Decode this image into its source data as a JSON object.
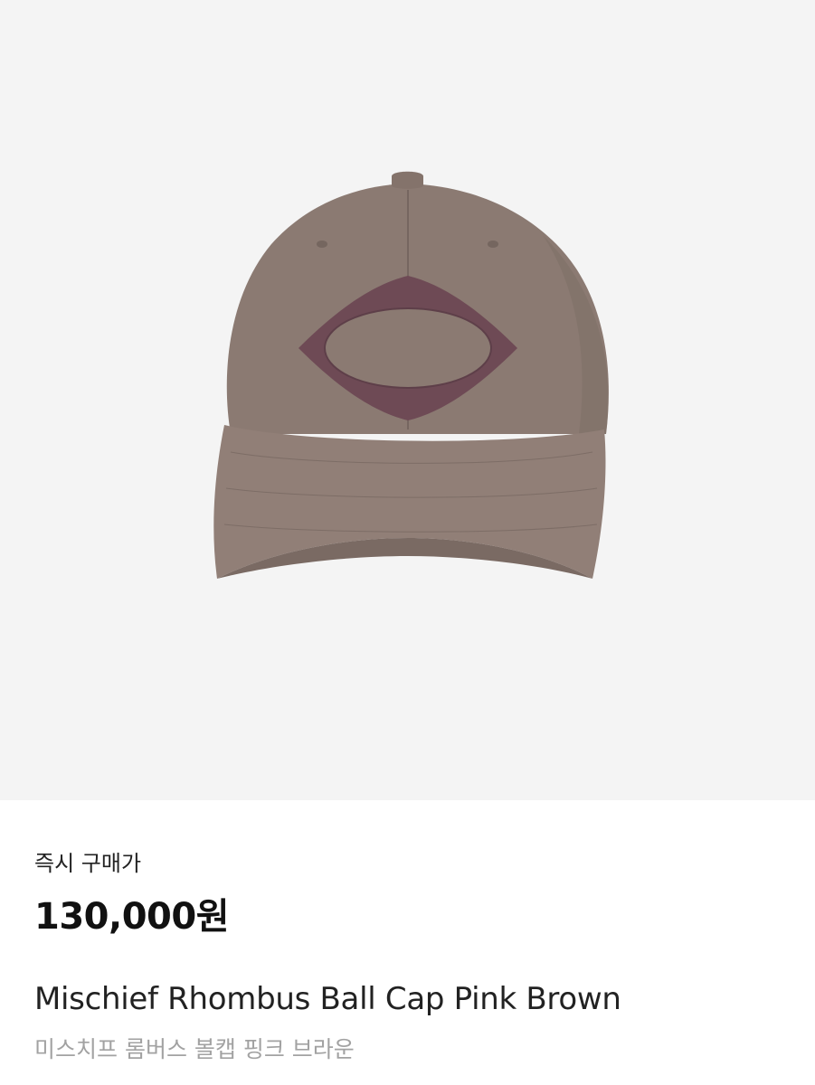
{
  "product": {
    "image_label": "cap-photo",
    "price_label": "즉시 구매가",
    "price": "130,000원",
    "name_en": "Mischief Rhombus Ball Cap Pink Brown",
    "name_ko": "미스치프 롬버스 볼캡 핑크 브라운"
  },
  "colors": {
    "image_bg": "#f4f4f4",
    "cap": "#8b7a72",
    "logo": "#6e4a55",
    "text_primary": "#222222",
    "text_secondary": "#a2a2a2"
  }
}
